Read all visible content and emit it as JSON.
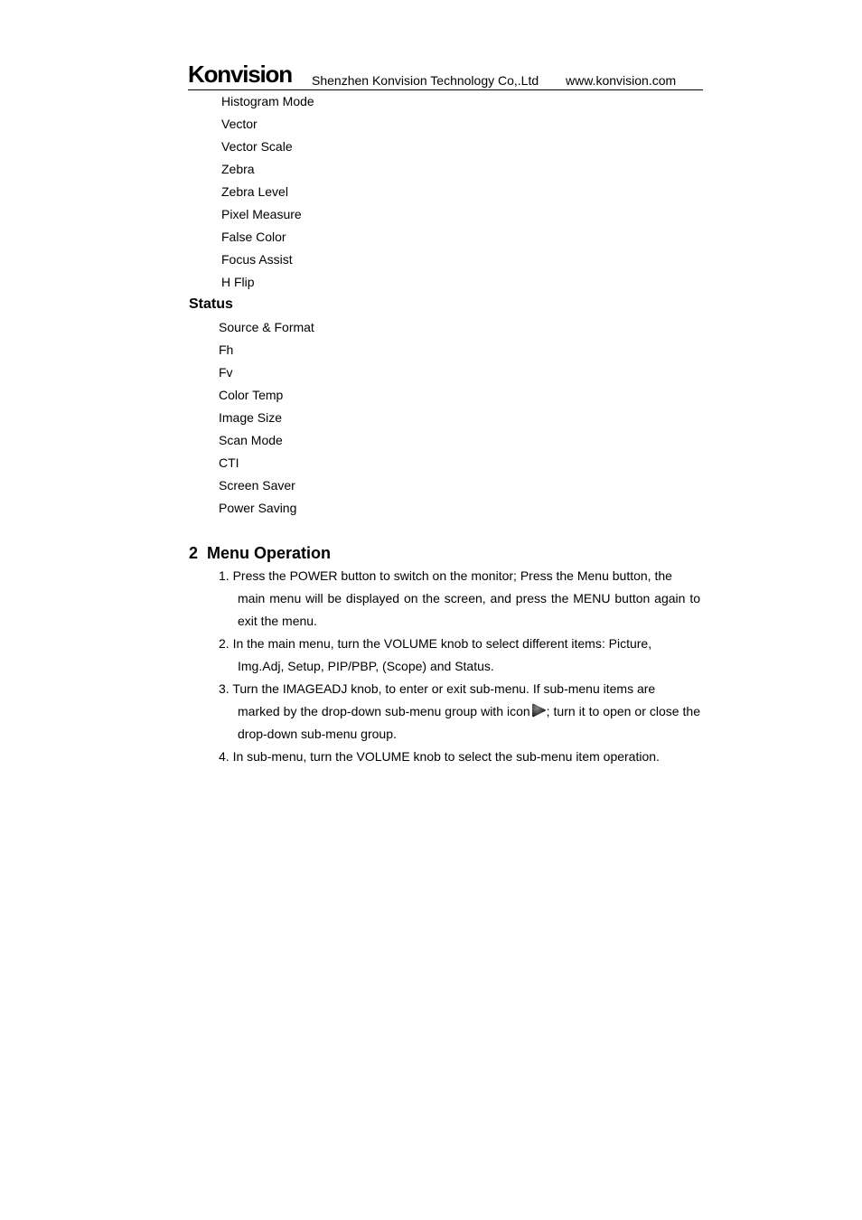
{
  "header": {
    "logo": "Konvision",
    "company": "Shenzhen Konvision Technology Co,.Ltd",
    "website": "www.konvision.com"
  },
  "scope_items": [
    "Histogram Mode",
    "Vector",
    "Vector Scale",
    "Zebra",
    "Zebra Level",
    "Pixel Measure",
    "False Color",
    "Focus Assist",
    "H Flip"
  ],
  "status": {
    "title": "Status",
    "items": [
      "Source & Format",
      "Fh",
      "Fv",
      "Color Temp",
      "Image Size",
      "Scan Mode",
      "CTI",
      "Screen Saver",
      "Power Saving"
    ]
  },
  "menu_operation": {
    "number": "2",
    "title": "Menu Operation",
    "steps": [
      {
        "line1": "1. Press the POWER button to switch on the monitor; Press the Menu button, the",
        "rest": "main menu will be displayed on the screen, and press the MENU button again to exit the menu."
      },
      {
        "line1": "2. In the main menu, turn the VOLUME knob to select different items: Picture,",
        "rest": "Img.Adj, Setup, PIP/PBP, (Scope) and Status."
      },
      {
        "line1": "3. Turn the IMAGEADJ knob, to enter or exit sub-menu. If sub-menu items are",
        "rest_before_icon": "marked by the drop-down sub-menu group with icon",
        "rest_after_icon": "; turn it to open or close the drop-down sub-menu group.",
        "icon": "play-triangle-icon"
      },
      {
        "line1": "4. In sub-menu, turn the VOLUME knob to select the sub-menu item operation.",
        "rest": ""
      }
    ]
  }
}
